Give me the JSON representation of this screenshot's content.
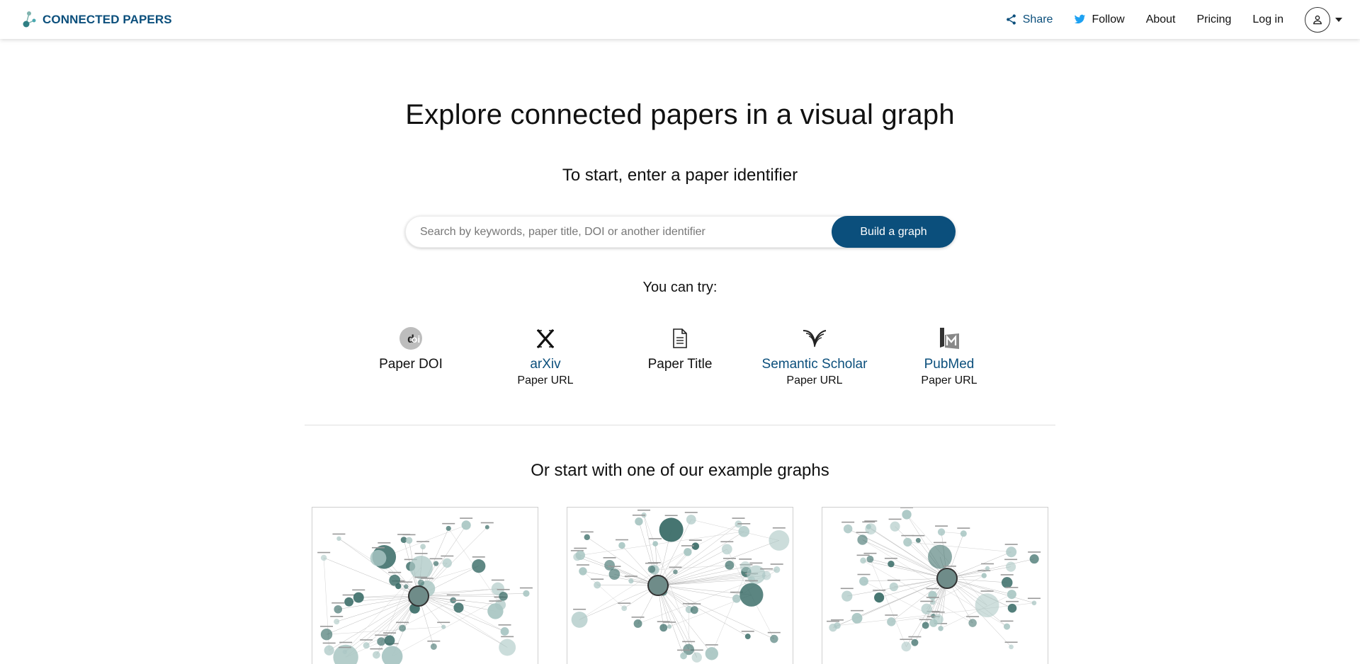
{
  "nav": {
    "logo_text": "CONNECTED PAPERS",
    "share": "Share",
    "follow": "Follow",
    "about": "About",
    "pricing": "Pricing",
    "login": "Log in"
  },
  "hero": {
    "title": "Explore connected papers in a visual graph",
    "subtitle": "To start, enter a paper identifier"
  },
  "search": {
    "placeholder": "Search by keywords, paper title, DOI or another identifier",
    "button": "Build a graph"
  },
  "try": {
    "label": "You can try:",
    "items": [
      {
        "name": "Paper DOI",
        "sub": ""
      },
      {
        "name": "arXiv",
        "sub": "Paper URL"
      },
      {
        "name": "Paper Title",
        "sub": ""
      },
      {
        "name": "Semantic Scholar",
        "sub": "Paper URL"
      },
      {
        "name": "PubMed",
        "sub": "Paper URL"
      }
    ]
  },
  "examples": {
    "title": "Or start with one of our example graphs"
  },
  "colors": {
    "brand": "#0b4f7c",
    "twitter": "#1da1f2",
    "node_dark": "#3c6e69",
    "node_light": "#a9c6c3"
  }
}
